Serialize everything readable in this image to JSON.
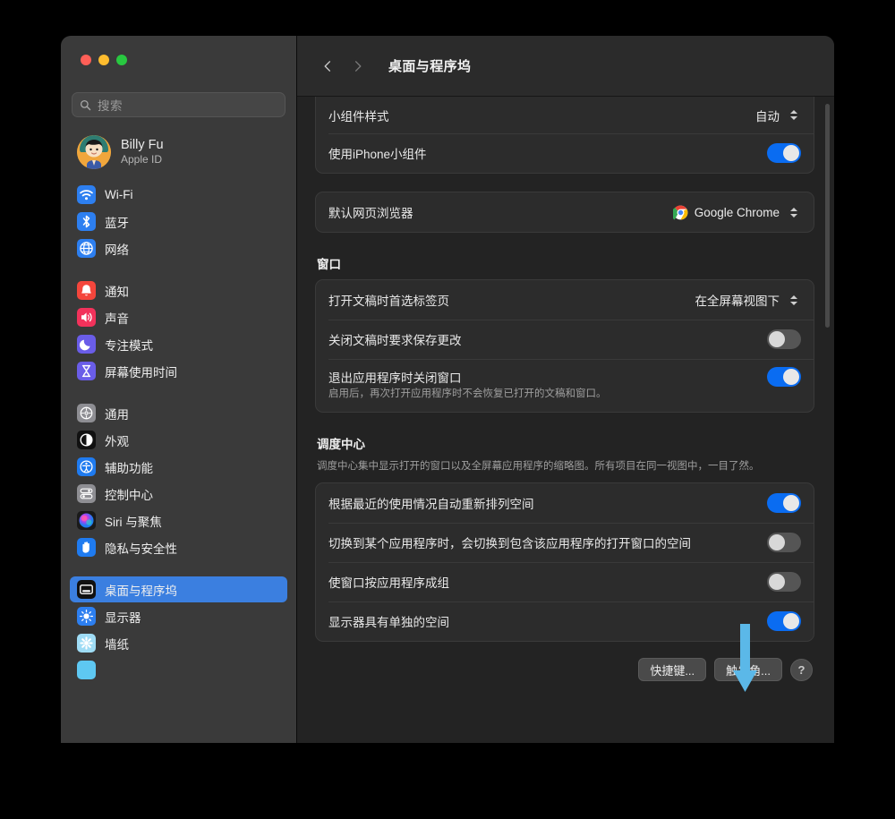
{
  "window": {
    "traffic_lights": [
      {
        "name": "close",
        "color": "#ff5f57"
      },
      {
        "name": "minimize",
        "color": "#febc2e"
      },
      {
        "name": "zoom",
        "color": "#28c840"
      }
    ]
  },
  "sidebar": {
    "search": {
      "placeholder": "搜索",
      "value": "",
      "icon": "search-icon"
    },
    "account": {
      "name": "Billy Fu",
      "subtitle": "Apple ID",
      "avatar": "user-avatar"
    },
    "groups": [
      {
        "items": [
          {
            "label": "Wi-Fi",
            "icon": "wifi-icon",
            "color": "#2d7ff0",
            "selected": false
          },
          {
            "label": "蓝牙",
            "icon": "bluetooth-icon",
            "color": "#2d7ff0",
            "selected": false
          },
          {
            "label": "网络",
            "icon": "network-globe-icon",
            "color": "#2d7ff0",
            "selected": false
          }
        ]
      },
      {
        "items": [
          {
            "label": "通知",
            "icon": "notifications-bell-icon",
            "color": "#f4463c",
            "selected": false
          },
          {
            "label": "声音",
            "icon": "sound-speaker-icon",
            "color": "#f2325b",
            "selected": false
          },
          {
            "label": "专注模式",
            "icon": "focus-moon-icon",
            "color": "#6a5de8",
            "selected": false
          },
          {
            "label": "屏幕使用时间",
            "icon": "screen-time-hourglass-icon",
            "color": "#6a5de8",
            "selected": false
          }
        ]
      },
      {
        "items": [
          {
            "label": "通用",
            "icon": "general-gear-icon",
            "color": "#8e8e93",
            "selected": false
          },
          {
            "label": "外观",
            "icon": "appearance-contrast-icon",
            "color": "#111111",
            "selected": false
          },
          {
            "label": "辅助功能",
            "icon": "accessibility-icon",
            "color": "#1f7bf0",
            "selected": false
          },
          {
            "label": "控制中心",
            "icon": "control-center-icon",
            "color": "#8e8e93",
            "selected": false
          },
          {
            "label": "Siri 与聚焦",
            "icon": "siri-orb-icon",
            "color": "#c64ba8",
            "selected": false
          },
          {
            "label": "隐私与安全性",
            "icon": "privacy-hand-icon",
            "color": "#1f7bf0",
            "selected": false
          }
        ]
      },
      {
        "items": [
          {
            "label": "桌面与程序坞",
            "icon": "desktop-dock-icon",
            "color": "#111111",
            "selected": true
          },
          {
            "label": "显示器",
            "icon": "displays-brightness-icon",
            "color": "#2d7ff0",
            "selected": false
          },
          {
            "label": "墙纸",
            "icon": "wallpaper-icon",
            "color": "#7dd3f5",
            "selected": false
          },
          {
            "label": "",
            "icon": "clipped-icon",
            "color": "#5ec8f2",
            "selected": false
          }
        ]
      }
    ]
  },
  "toolbar": {
    "back_icon": "chevron-left-icon",
    "forward_icon": "chevron-right-icon",
    "title": "桌面与程序坞"
  },
  "main": {
    "widget_card": {
      "rows": [
        {
          "label": "小组件样式",
          "control": "popup",
          "value": "自动"
        },
        {
          "label": "使用iPhone小组件",
          "control": "toggle",
          "on": true
        }
      ]
    },
    "browser_card": {
      "rows": [
        {
          "label": "默认网页浏览器",
          "control": "popup",
          "value": "Google Chrome",
          "icon": "chrome-icon"
        }
      ]
    },
    "window_section": {
      "title": "窗口",
      "rows": [
        {
          "label": "打开文稿时首选标签页",
          "control": "popup",
          "value": "在全屏幕视图下"
        },
        {
          "label": "关闭文稿时要求保存更改",
          "control": "toggle",
          "on": false
        },
        {
          "label": "退出应用程序时关闭窗口",
          "control": "toggle",
          "on": true,
          "sub": "启用后，再次打开应用程序时不会恢复已打开的文稿和窗口。"
        }
      ]
    },
    "mission_control_section": {
      "title": "调度中心",
      "description": "调度中心集中显示打开的窗口以及全屏幕应用程序的缩略图。所有项目在同一视图中，一目了然。",
      "rows": [
        {
          "label": "根据最近的使用情况自动重新排列空间",
          "control": "toggle",
          "on": true
        },
        {
          "label": "切换到某个应用程序时，会切换到包含该应用程序的打开窗口的空间",
          "control": "toggle",
          "on": false
        },
        {
          "label": "使窗口按应用程序成组",
          "control": "toggle",
          "on": false
        },
        {
          "label": "显示器具有单独的空间",
          "control": "toggle",
          "on": true
        }
      ]
    },
    "footer": {
      "shortcuts_button": "快捷键...",
      "hot_corners_button": "触发角...",
      "help_button": "?"
    }
  },
  "annotation": {
    "arrow": {
      "color": "#5bb8e8",
      "points_to": "触发角..."
    }
  },
  "colors": {
    "accent": "#0a6cf1",
    "selection": "#3b7fe0",
    "window_bg": "#232323",
    "sidebar_bg": "#3a3a3a",
    "card_bg": "#2c2c2c"
  }
}
